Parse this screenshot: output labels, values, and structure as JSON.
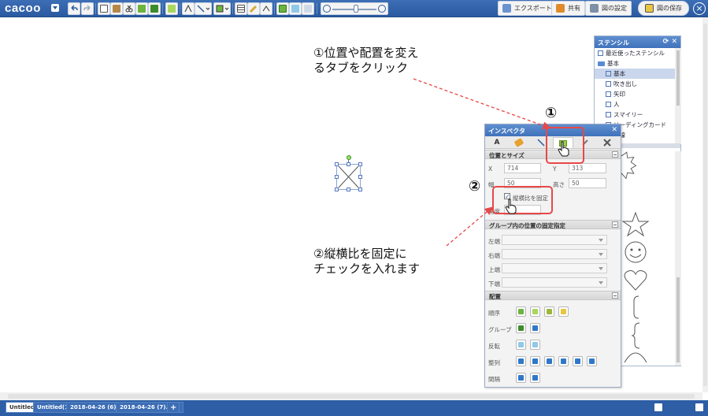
{
  "app": {
    "logo": "cacoo"
  },
  "header": {
    "export_label": "エクスポート",
    "share_label": "共有",
    "settings_label": "図の設定",
    "save_label": "図の保存"
  },
  "annotations": {
    "note1_line1": "①位置や配置を変え",
    "note1_line2": "るタブをクリック",
    "note2_line1": "②縦横比を固定に",
    "note2_line2": "チェックを入れます",
    "marker1": "①",
    "marker2": "②"
  },
  "stencil": {
    "title": "ステンシル",
    "items": [
      {
        "label": "最近使ったステンシル"
      },
      {
        "label": "基本"
      },
      {
        "label": "基本"
      },
      {
        "label": "吹き出し"
      },
      {
        "label": "矢印"
      },
      {
        "label": "人"
      },
      {
        "label": "スマイリー"
      },
      {
        "label": "リーディングカード"
      },
      {
        "label": "点線"
      }
    ]
  },
  "inspector": {
    "title": "インスペクタ",
    "tab_text": "A",
    "position_section": "位置とサイズ",
    "x_label": "X",
    "x_value": "714",
    "y_label": "Y",
    "y_value": "313",
    "width_label": "幅",
    "width_value": "50",
    "height_label": "高さ",
    "height_value": "50",
    "lock_ratio_label": "縦横比を固定",
    "angle_label": "角度",
    "group_section": "グループ内の位置の固定指定",
    "left_label": "左端",
    "right_label": "右端",
    "top_label": "上端",
    "bottom_label": "下端",
    "arrange_section": "配置",
    "order_label": "順序",
    "group_label": "グループ",
    "flip_label": "反転",
    "align_label": "整列",
    "spacing_label": "間隔"
  },
  "bottom_tabs": [
    {
      "label": "Untitled"
    },
    {
      "label": "Untitled(1)"
    },
    {
      "label": "2018-04-26 (6).png"
    },
    {
      "label": "2018-04-26 (7).png"
    },
    {
      "label": "+"
    }
  ],
  "colors": {
    "brand": "#2a5aa0",
    "highlight": "#e74848",
    "arrange_green": "#6db33f",
    "arrange_blue": "#2f78c8",
    "toolbar_yellow": "#e8c640"
  }
}
